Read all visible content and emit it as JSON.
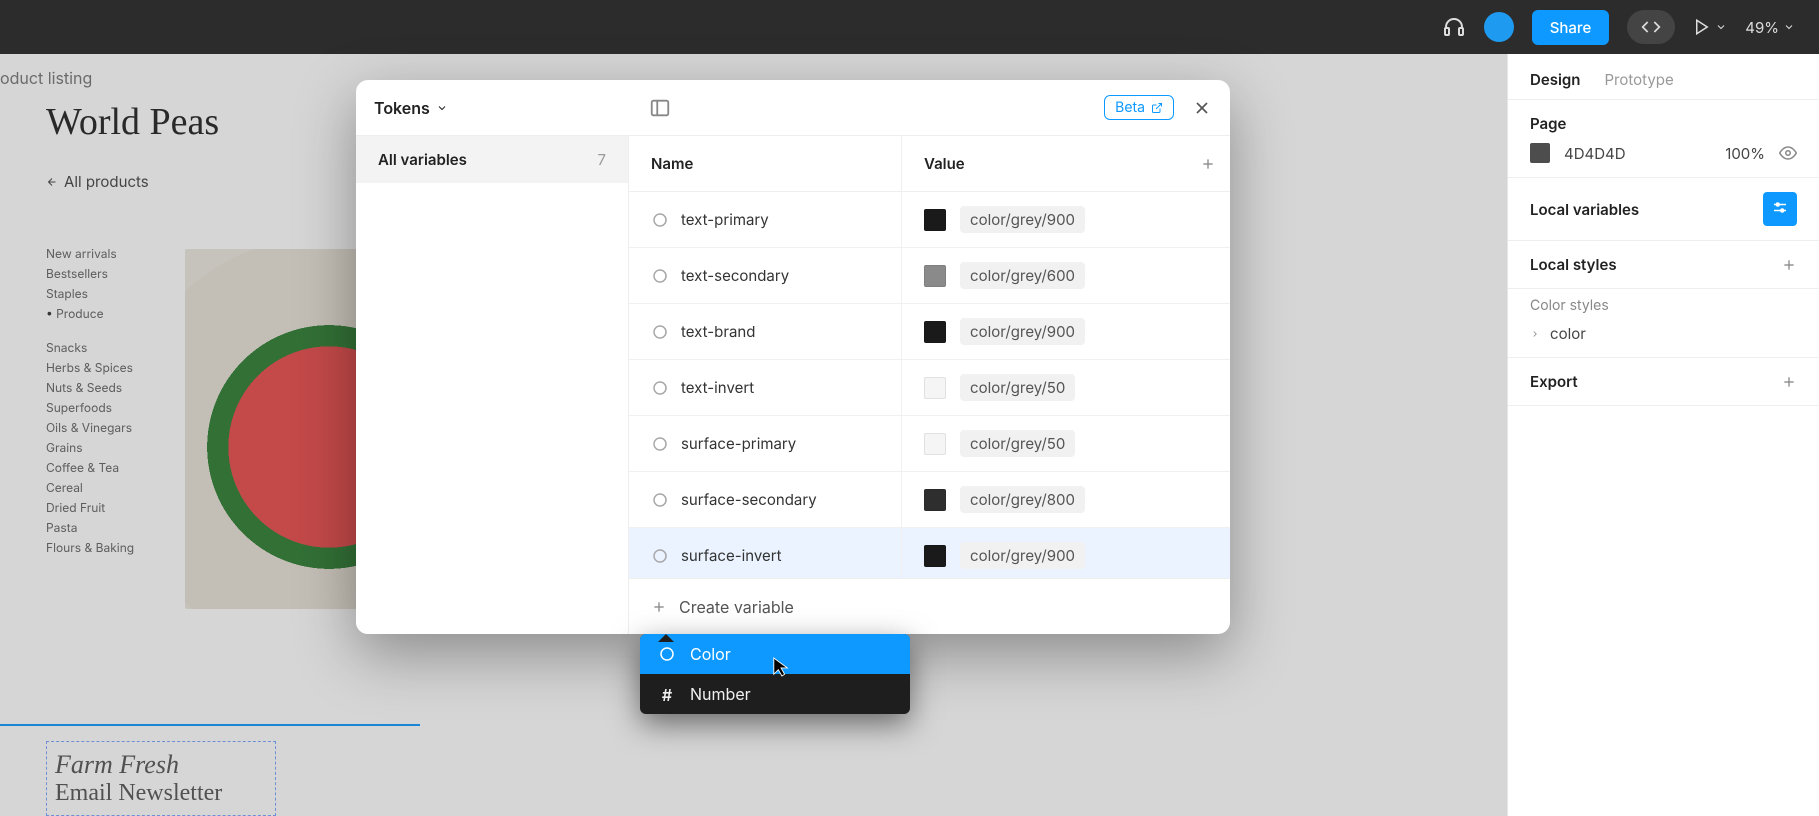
{
  "topbar": {
    "share_label": "Share",
    "zoom_label": "49%"
  },
  "canvas": {
    "frame_label": "oduct listing",
    "brand_title": "World Peas",
    "back_link": "All products",
    "categories_group1": [
      "New arrivals",
      "Bestsellers",
      "Staples"
    ],
    "categories_active": "Produce",
    "categories_group2": [
      "Snacks",
      "Herbs & Spices",
      "Nuts & Seeds",
      "Superfoods",
      "Oils & Vinegars",
      "Grains",
      "Coffee & Tea",
      "Cereal",
      "Dried Fruit",
      "Pasta",
      "Flours & Baking"
    ],
    "farm_line1": "Farm Fresh",
    "farm_line2": "Email Newsletter"
  },
  "modal": {
    "title": "Tokens",
    "beta_label": "Beta",
    "sidebar": {
      "all_variables_label": "All variables",
      "count": "7"
    },
    "headers": {
      "name": "Name",
      "value": "Value"
    },
    "rows": [
      {
        "name": "text-primary",
        "token": "color/grey/900",
        "swatch": "#1a1a1a"
      },
      {
        "name": "text-secondary",
        "token": "color/grey/600",
        "swatch": "#8a8a8a"
      },
      {
        "name": "text-brand",
        "token": "color/grey/900",
        "swatch": "#1a1a1a"
      },
      {
        "name": "text-invert",
        "token": "color/grey/50",
        "swatch": "#f5f5f5"
      },
      {
        "name": "surface-primary",
        "token": "color/grey/50",
        "swatch": "#f5f5f5"
      },
      {
        "name": "surface-secondary",
        "token": "color/grey/800",
        "swatch": "#2e2e2e"
      },
      {
        "name": "surface-invert",
        "token": "color/grey/900",
        "swatch": "#1a1a1a"
      }
    ],
    "create_label": "Create variable",
    "dropdown": {
      "color": "Color",
      "number": "Number"
    }
  },
  "right_panel": {
    "tabs": {
      "design": "Design",
      "prototype": "Prototype"
    },
    "page": {
      "title": "Page",
      "hex": "4D4D4D",
      "opacity": "100%"
    },
    "local_variables": "Local variables",
    "local_styles": "Local styles",
    "color_styles": "Color styles",
    "color_item": "color",
    "export": "Export"
  }
}
